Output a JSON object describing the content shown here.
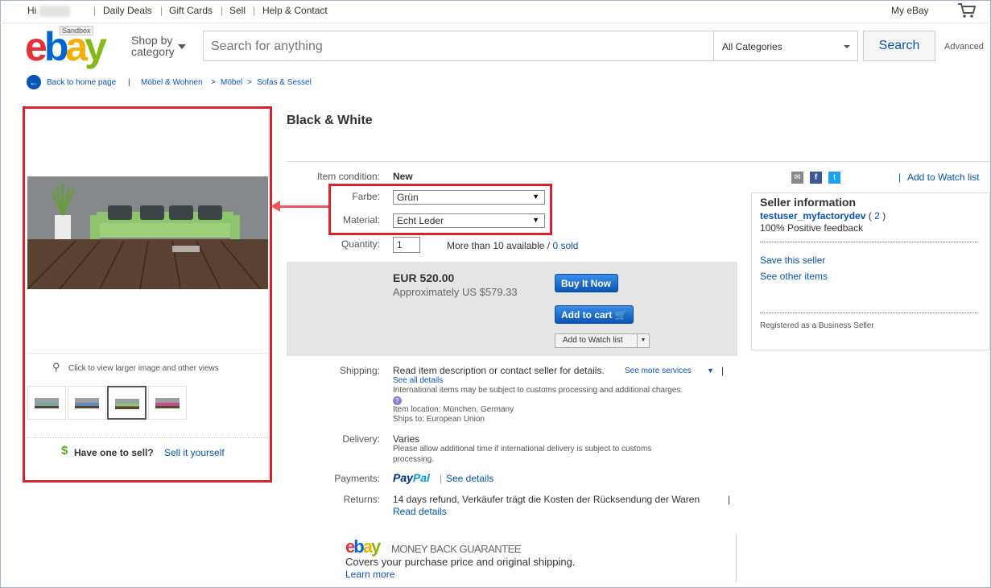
{
  "topbar": {
    "hi": "Hi",
    "links": [
      "Daily Deals",
      "Gift Cards",
      "Sell",
      "Help & Contact"
    ],
    "my_ebay": "My eBay"
  },
  "header": {
    "sandbox_badge": "Sandbox",
    "logo": [
      "e",
      "b",
      "a",
      "y"
    ],
    "shop_by_line1": "Shop by",
    "shop_by_line2": "category",
    "search_placeholder": "Search for anything",
    "category_selected": "All Categories",
    "search_button": "Search",
    "advanced": "Advanced"
  },
  "breadcrumb": {
    "back": "Back to home page",
    "items": [
      "Möbel & Wohnen",
      "Möbel",
      "Sofas & Sessel"
    ]
  },
  "gallery": {
    "zoom_hint": "Click to view larger image and other views",
    "sell_prompt": "Have one to sell?",
    "sell_link": "Sell it yourself"
  },
  "item": {
    "title": "Black & White",
    "condition_label": "Item condition:",
    "condition_value": "New",
    "farbe_label": "Farbe:",
    "farbe_value": "Grün",
    "material_label": "Material:",
    "material_value": "Echt Leder",
    "quantity_label": "Quantity:",
    "quantity_value": "1",
    "availability": "More than 10 available",
    "sold": "0 sold",
    "price": "EUR 520.00",
    "approx": "Approximately US $579.33",
    "buy_now": "Buy It Now",
    "add_to_cart": "Add to cart",
    "add_to_watch": "Add to Watch list"
  },
  "shipping": {
    "label": "Shipping:",
    "text": "Read item description or contact seller for details.",
    "more_services": "See more services",
    "see_all": "See all details",
    "intl_note": "International items may be subject to customs processing and additional charges.",
    "location": "Item location: München, Germany",
    "ships_to": "Ships to: European Union"
  },
  "delivery": {
    "label": "Delivery:",
    "value": "Varies",
    "note_line1": "Please allow additional time if international delivery is subject to customs",
    "note_line2": "processing."
  },
  "payments": {
    "label": "Payments:",
    "paypal_pay": "Pay",
    "paypal_pal": "Pal",
    "see_details": "See details"
  },
  "returns": {
    "label": "Returns:",
    "text": "14 days refund, Verkäufer trägt die Kosten der Rücksendung der Waren",
    "read_details": "Read details"
  },
  "guarantee": {
    "title": "MONEY BACK GUARANTEE",
    "text": "Covers your purchase price and original shipping.",
    "learn_more": "Learn more"
  },
  "right_panel": {
    "add_to_watch": "Add to Watch list",
    "seller_heading": "Seller information",
    "seller_name": "testuser_myfactorydev",
    "feedback_count": "2",
    "positive": "100% Positive feedback",
    "save_seller": "Save this seller",
    "other_items": "See other items",
    "registered": "Registered as a Business Seller"
  },
  "colors": {
    "link": "#0654ba",
    "annotation_red": "#d9222a",
    "ebay_red": "#e53238",
    "ebay_blue": "#0064d2",
    "ebay_yellow": "#f5af02",
    "ebay_green": "#86b817"
  }
}
